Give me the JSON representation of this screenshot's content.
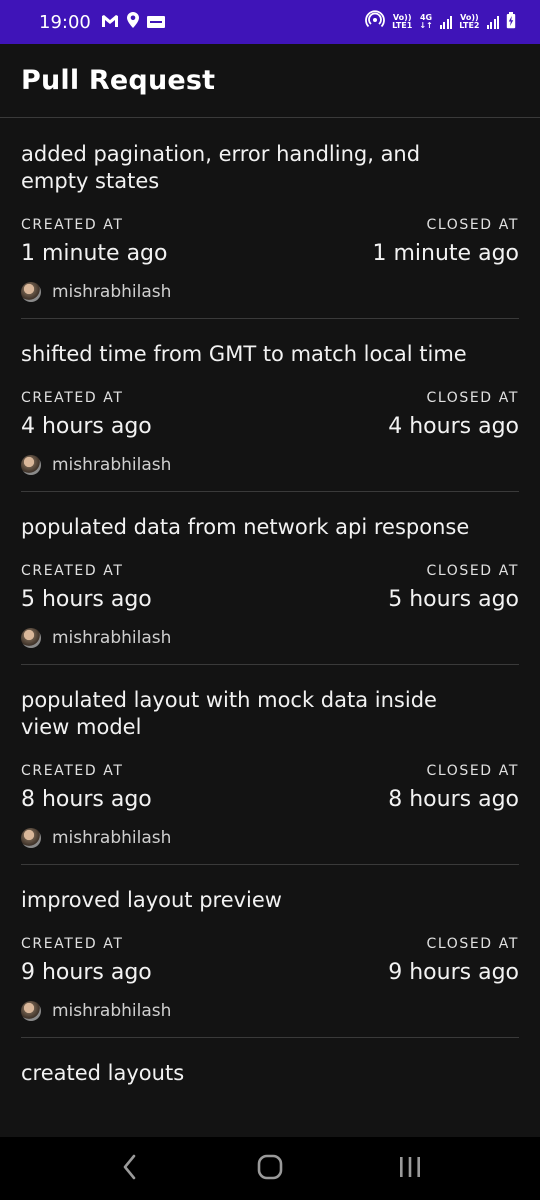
{
  "status_bar": {
    "time": "19:00",
    "sim1_label_top": "Vo))",
    "sim1_label_bottom": "LTE1",
    "net_label_top": "4G",
    "net_label_bottom": "↓↑",
    "sim2_label_top": "Vo))",
    "sim2_label_bottom": "LTE2"
  },
  "app_bar": {
    "title": "Pull Request"
  },
  "pull_requests": [
    {
      "title": "added pagination, error handling, and empty states",
      "created_label": "CREATED AT",
      "closed_label": "CLOSED AT",
      "created_at": "1 minute ago",
      "closed_at": "1 minute ago",
      "author": "mishrabhilash"
    },
    {
      "title": "shifted time from GMT to match local time",
      "created_label": "CREATED AT",
      "closed_label": "CLOSED AT",
      "created_at": "4 hours ago",
      "closed_at": "4 hours ago",
      "author": "mishrabhilash"
    },
    {
      "title": "populated data from network api response",
      "created_label": "CREATED AT",
      "closed_label": "CLOSED AT",
      "created_at": "5 hours ago",
      "closed_at": "5 hours ago",
      "author": "mishrabhilash"
    },
    {
      "title": "populated layout with mock data inside view model",
      "created_label": "CREATED AT",
      "closed_label": "CLOSED AT",
      "created_at": "8 hours ago",
      "closed_at": "8 hours ago",
      "author": "mishrabhilash"
    },
    {
      "title": "improved layout preview",
      "created_label": "CREATED AT",
      "closed_label": "CLOSED AT",
      "created_at": "9 hours ago",
      "closed_at": "9 hours ago",
      "author": "mishrabhilash"
    },
    {
      "title": "created layouts"
    }
  ],
  "nav_bar": {
    "back_icon": "back-icon",
    "home_icon": "home-icon",
    "recents_icon": "recents-icon"
  },
  "colors": {
    "status_bar_bg": "#3f14b8",
    "background": "#131313",
    "divider": "#3a3a3a",
    "nav_bar_bg": "#000000"
  }
}
